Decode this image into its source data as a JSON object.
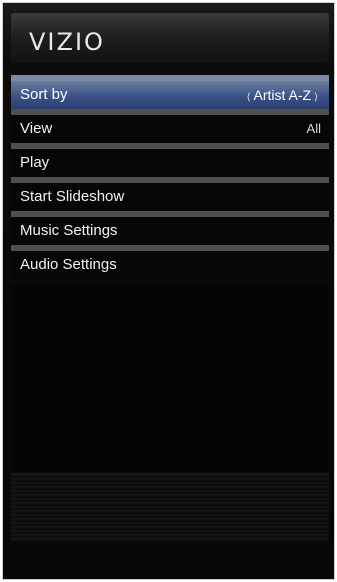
{
  "header": {
    "brand": "VIZIO"
  },
  "menu": {
    "items": [
      {
        "label": "Sort by",
        "value": "Artist A-Z",
        "selected": true
      },
      {
        "label": "View",
        "value": "All",
        "selected": false
      },
      {
        "label": "Play",
        "value": "",
        "selected": false
      },
      {
        "label": "Start Slideshow",
        "value": "",
        "selected": false
      },
      {
        "label": "Music Settings",
        "value": "",
        "selected": false
      },
      {
        "label": "Audio Settings",
        "value": "",
        "selected": false
      }
    ]
  },
  "colors": {
    "selected_row": "#3b5288",
    "row_separator": "#4f4f4f",
    "background": "#060606"
  },
  "icons": {
    "left_arrow": "chevron-left-icon",
    "right_arrow": "chevron-right-icon"
  }
}
